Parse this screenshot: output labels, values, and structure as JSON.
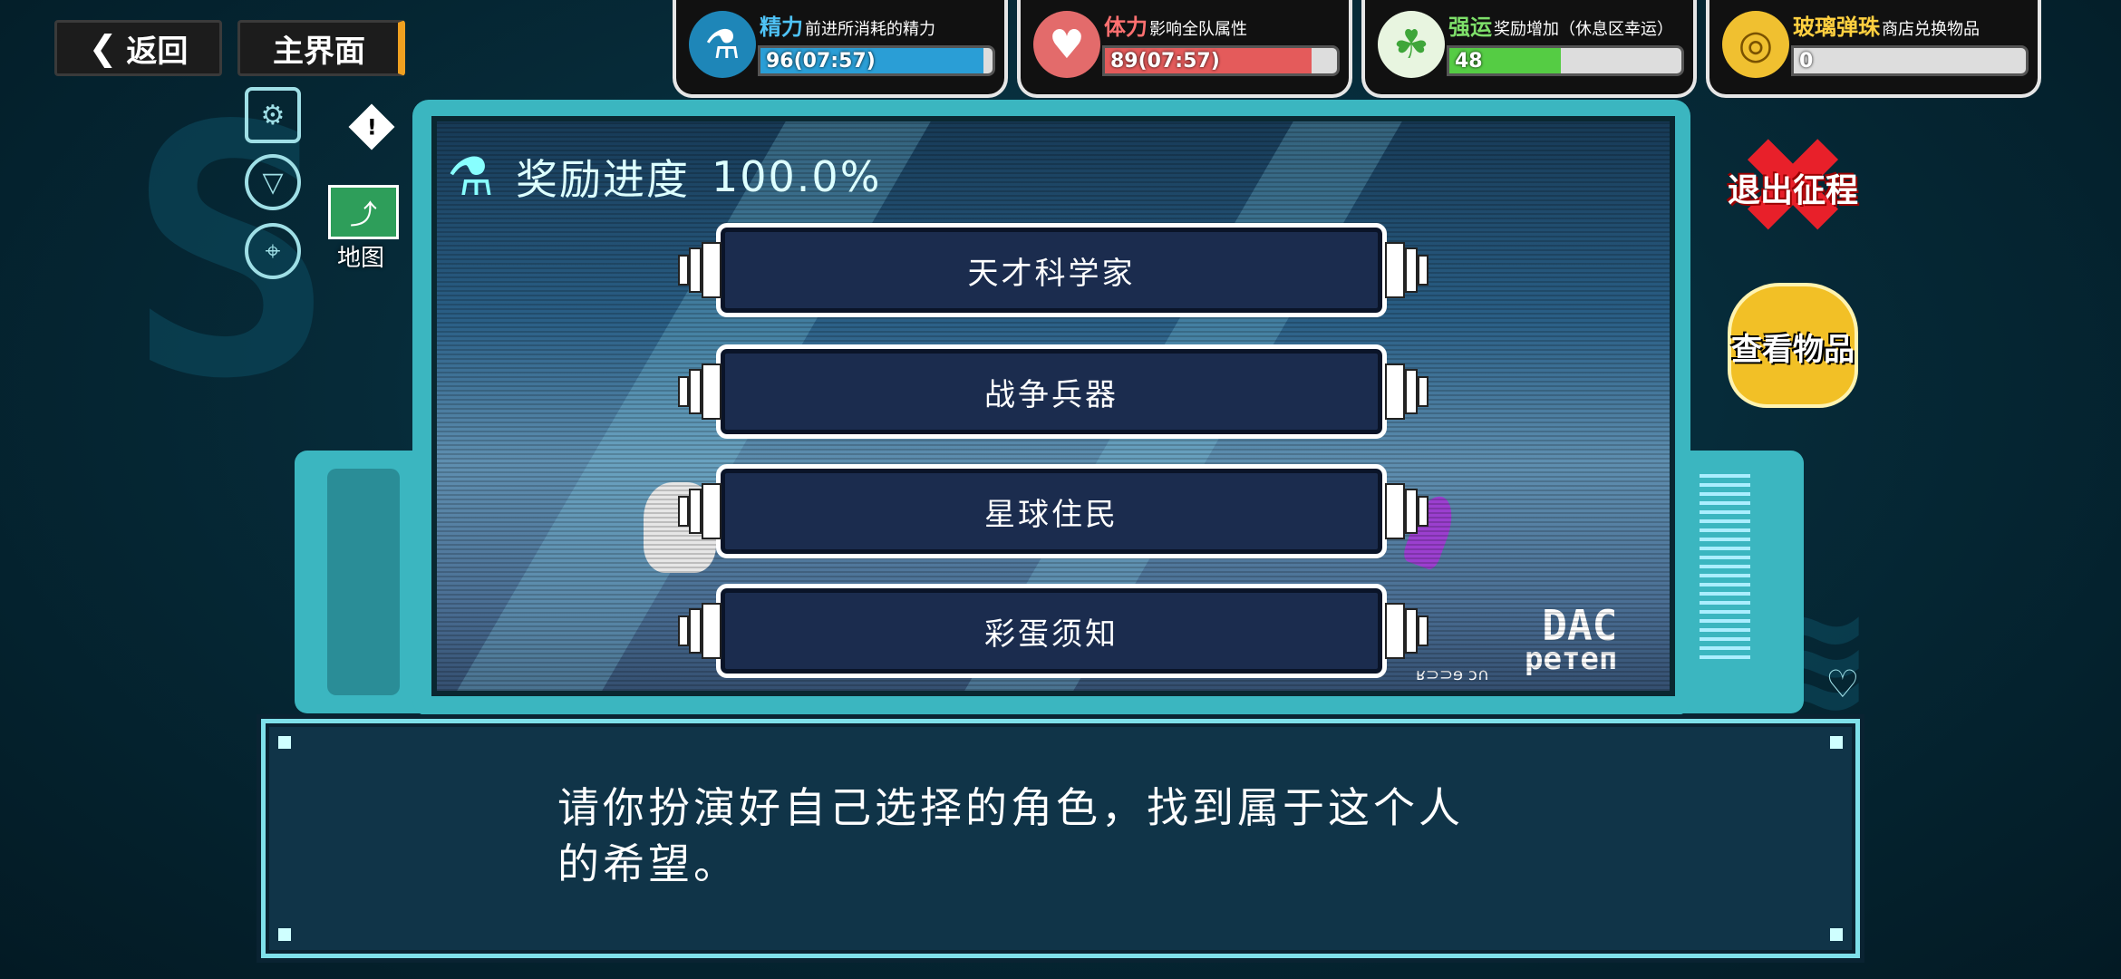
{
  "top_nav": {
    "back_label": "返回",
    "home_label": "主界面"
  },
  "resources": [
    {
      "name": "精力",
      "desc": "前进所消耗的精力",
      "value": "96(07:57)",
      "fill": 0.96,
      "color": "#29a6d8",
      "icon": "potion-icon"
    },
    {
      "name": "体力",
      "desc": "影响全队属性",
      "value": "89(07:57)",
      "fill": 0.89,
      "color": "#e65a5a",
      "icon": "heart-icon"
    },
    {
      "name": "强运",
      "desc": "奖励增加（休息区幸运）",
      "value": "48",
      "fill": 0.48,
      "color": "#5ed64a",
      "icon": "clover-icon"
    },
    {
      "name": "玻璃弹珠",
      "desc": "商店兑换物品",
      "value": "0",
      "fill": 0.0,
      "color": "#e8b020",
      "icon": "coin-icon"
    }
  ],
  "sidebar": {
    "map_label": "地图"
  },
  "progress": {
    "label": "奖励进度",
    "value": "100.0%"
  },
  "choices": [
    "天才科学家",
    "战争兵器",
    "星球住民",
    "彩蛋须知"
  ],
  "right_actions": {
    "exit_label": "退出征程",
    "view_items_label": "查看物品"
  },
  "dialog": {
    "text_line1": "请你扮演好自己选择的角色，找到属于这个人",
    "text_line2": "的希望。"
  },
  "logo": {
    "line1": "DAC",
    "line2": "ретеп",
    "sub": "ʁ⊃⊃ɘ ↄ∩"
  }
}
